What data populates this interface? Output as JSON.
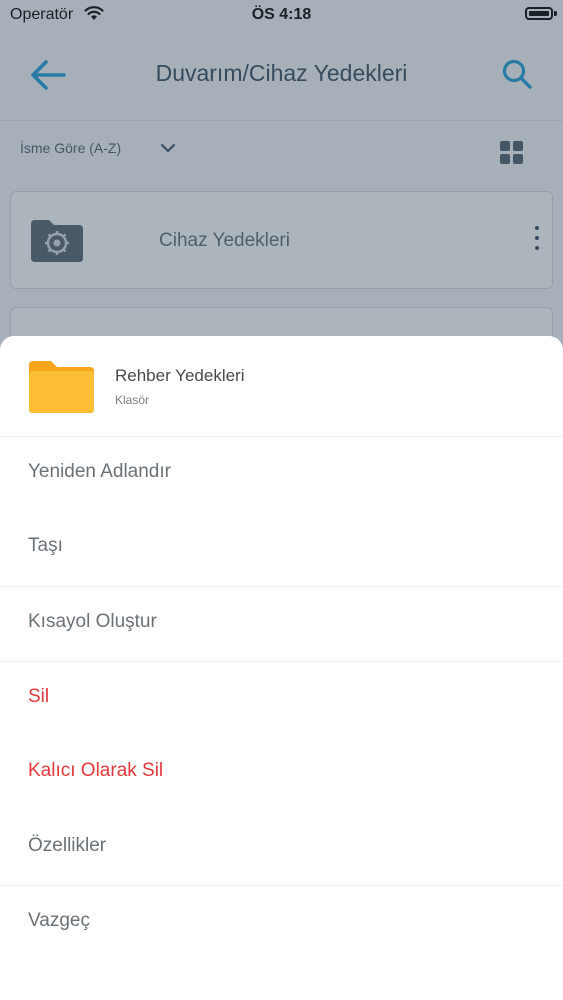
{
  "status_bar": {
    "carrier": "Operatör",
    "time": "ÖS 4:18"
  },
  "nav": {
    "title": "Duvarım/Cihaz Yedekleri",
    "back_icon": "arrow-left-icon",
    "search_icon": "search-icon"
  },
  "toolbar": {
    "sort_label": "İsme Göre (A-Z)",
    "view_icon": "grid-view-icon"
  },
  "folders": [
    {
      "name": "Cihaz Yedekleri",
      "icon": "settings-folder-icon"
    },
    {
      "name": "",
      "icon": ""
    }
  ],
  "sheet": {
    "item_name": "Rehber Yedekleri",
    "item_type": "Klasör",
    "item_icon": "folder-icon",
    "actions": [
      {
        "label": "Yeniden Adlandır",
        "style": "normal"
      },
      {
        "label": "Taşı",
        "style": "normal"
      },
      {
        "label": "Kısayol Oluştur",
        "style": "normal"
      },
      {
        "label": "Sil",
        "style": "danger"
      },
      {
        "label": "Kalıcı Olarak Sil",
        "style": "danger"
      },
      {
        "label": "Özellikler",
        "style": "normal"
      },
      {
        "label": "Vazgeç",
        "style": "normal"
      }
    ]
  },
  "colors": {
    "accent": "#1a9bd7",
    "danger": "#e0393c",
    "folder": "#fcb62c"
  }
}
